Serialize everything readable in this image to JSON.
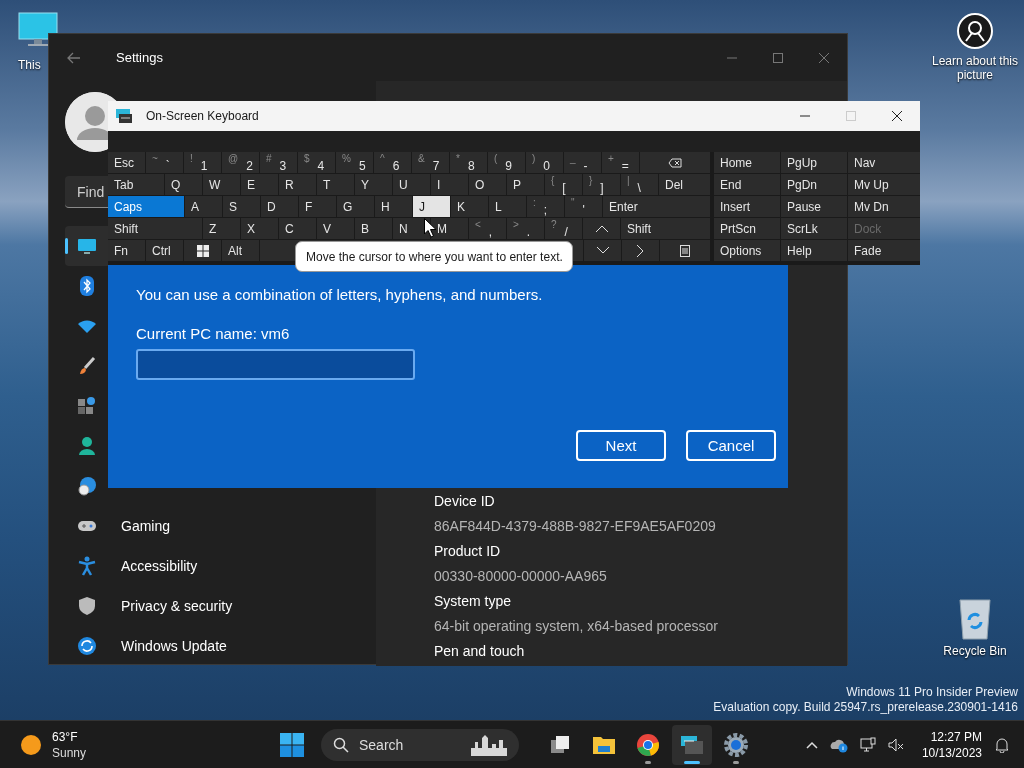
{
  "desktop": {
    "this_pc_label": "This",
    "learn_label": "Learn about this picture",
    "recycle_bin_label": "Recycle Bin"
  },
  "settings": {
    "title": "Settings",
    "search_placeholder": "Find",
    "sidebar": [
      {
        "selected": true
      },
      {
        "selected": false
      },
      {
        "selected": false
      },
      {
        "selected": false
      },
      {
        "selected": false
      },
      {
        "selected": false
      },
      {
        "selected": false
      },
      {
        "label": "Gaming",
        "selected": false
      },
      {
        "label": "Accessibility",
        "selected": false
      },
      {
        "label": "Privacy & security",
        "selected": false
      },
      {
        "label": "Windows Update",
        "selected": false
      }
    ],
    "about": [
      {
        "label": "Device ID",
        "value": "86AF844D-4379-488B-9827-EF9AE5AF0209"
      },
      {
        "label": "Product ID",
        "value": "00330-80000-00000-AA965"
      },
      {
        "label": "System type",
        "value": "64-bit operating system, x64-based processor"
      },
      {
        "label": "Pen and touch"
      }
    ]
  },
  "rename_dialog": {
    "hint": "You can use a combination of letters, hyphens, and numbers.",
    "current_name": "Current PC name: vm6",
    "buttons": [
      "Next",
      "Cancel"
    ]
  },
  "osk": {
    "title": "On-Screen Keyboard",
    "main_rows": [
      [
        {
          "kind": "text",
          "label": "Esc",
          "on": false,
          "hovered": false
        },
        {
          "kind": "dual",
          "shift": "~",
          "label": "`",
          "on": false,
          "hovered": false
        },
        {
          "kind": "dual",
          "shift": "!",
          "label": "1",
          "on": false,
          "hovered": false
        },
        {
          "kind": "dual",
          "shift": "@",
          "label": "2",
          "on": false,
          "hovered": false
        },
        {
          "kind": "dual",
          "shift": "#",
          "label": "3",
          "on": false,
          "hovered": false
        },
        {
          "kind": "dual",
          "shift": "$",
          "label": "4",
          "on": false,
          "hovered": false
        },
        {
          "kind": "dual",
          "shift": "%",
          "label": "5",
          "on": false,
          "hovered": false
        },
        {
          "kind": "dual",
          "shift": "^",
          "label": "6",
          "on": false,
          "hovered": false
        },
        {
          "kind": "dual",
          "shift": "&",
          "label": "7",
          "on": false,
          "hovered": false
        },
        {
          "kind": "dual",
          "shift": "*",
          "label": "8",
          "on": false,
          "hovered": false
        },
        {
          "kind": "dual",
          "shift": "(",
          "label": "9",
          "on": false,
          "hovered": false
        },
        {
          "kind": "dual",
          "shift": ")",
          "label": "0",
          "on": false,
          "hovered": false
        },
        {
          "kind": "dual",
          "shift": "_",
          "label": "-",
          "on": false,
          "hovered": false
        },
        {
          "kind": "dual",
          "shift": "+",
          "label": "=",
          "on": false,
          "hovered": false
        },
        {
          "kind": "backspace",
          "on": false,
          "hovered": false
        }
      ],
      [
        {
          "kind": "text",
          "label": "Tab",
          "on": false,
          "hovered": false
        },
        {
          "kind": "text",
          "label": "Q",
          "on": false,
          "hovered": false
        },
        {
          "kind": "text",
          "label": "W",
          "on": false,
          "hovered": false
        },
        {
          "kind": "text",
          "label": "E",
          "on": false,
          "hovered": false
        },
        {
          "kind": "text",
          "label": "R",
          "on": false,
          "hovered": false
        },
        {
          "kind": "text",
          "label": "T",
          "on": false,
          "hovered": false
        },
        {
          "kind": "text",
          "label": "Y",
          "on": false,
          "hovered": false
        },
        {
          "kind": "text",
          "label": "U",
          "on": false,
          "hovered": false
        },
        {
          "kind": "text",
          "label": "I",
          "on": false,
          "hovered": false
        },
        {
          "kind": "text",
          "label": "O",
          "on": false,
          "hovered": false
        },
        {
          "kind": "text",
          "label": "P",
          "on": false,
          "hovered": false
        },
        {
          "kind": "dual",
          "shift": "{",
          "label": "[",
          "on": false,
          "hovered": false
        },
        {
          "kind": "dual",
          "shift": "}",
          "label": "]",
          "on": false,
          "hovered": false
        },
        {
          "kind": "dual",
          "shift": "|",
          "label": "\\",
          "on": false,
          "hovered": false
        },
        {
          "kind": "text",
          "label": "Del",
          "on": false,
          "hovered": false
        }
      ],
      [
        {
          "kind": "text",
          "label": "Caps",
          "on": true,
          "hovered": false
        },
        {
          "kind": "text",
          "label": "A",
          "on": false,
          "hovered": false
        },
        {
          "kind": "text",
          "label": "S",
          "on": false,
          "hovered": false
        },
        {
          "kind": "text",
          "label": "D",
          "on": false,
          "hovered": false
        },
        {
          "kind": "text",
          "label": "F",
          "on": false,
          "hovered": false
        },
        {
          "kind": "text",
          "label": "G",
          "on": false,
          "hovered": false
        },
        {
          "kind": "text",
          "label": "H",
          "on": false,
          "hovered": false
        },
        {
          "kind": "text",
          "label": "J",
          "on": false,
          "hovered": true
        },
        {
          "kind": "text",
          "label": "K",
          "on": false,
          "hovered": false
        },
        {
          "kind": "text",
          "label": "L",
          "on": false,
          "hovered": false
        },
        {
          "kind": "dual",
          "shift": ":",
          "label": ";",
          "on": false,
          "hovered": false
        },
        {
          "kind": "dual",
          "shift": "\"",
          "label": "'",
          "on": false,
          "hovered": false
        },
        {
          "kind": "text",
          "label": "Enter",
          "on": false,
          "hovered": false
        }
      ],
      [
        {
          "kind": "text",
          "label": "Shift",
          "on": false,
          "hovered": false
        },
        {
          "kind": "text",
          "label": "Z",
          "on": false,
          "hovered": false
        },
        {
          "kind": "text",
          "label": "X",
          "on": false,
          "hovered": false
        },
        {
          "kind": "text",
          "label": "C",
          "on": false,
          "hovered": false
        },
        {
          "kind": "text",
          "label": "V",
          "on": false,
          "hovered": false
        },
        {
          "kind": "text",
          "label": "B",
          "on": false,
          "hovered": false
        },
        {
          "kind": "text",
          "label": "N",
          "on": false,
          "hovered": false
        },
        {
          "kind": "text",
          "label": "M",
          "on": false,
          "hovered": false
        },
        {
          "kind": "dual",
          "shift": "<",
          "label": ",",
          "on": false,
          "hovered": false
        },
        {
          "kind": "dual",
          "shift": ">",
          "label": ".",
          "on": false,
          "hovered": false
        },
        {
          "kind": "dual",
          "shift": "?",
          "label": "/",
          "on": false,
          "hovered": false
        },
        {
          "kind": "up",
          "on": false,
          "hovered": false
        },
        {
          "kind": "text",
          "label": "Shift",
          "on": false,
          "hovered": false
        }
      ],
      [
        {
          "kind": "text",
          "label": "Fn",
          "on": false,
          "hovered": false
        },
        {
          "kind": "text",
          "label": "Ctrl",
          "on": false,
          "hovered": false
        },
        {
          "kind": "windows",
          "on": false,
          "hovered": false
        },
        {
          "kind": "text",
          "label": "Alt",
          "on": false,
          "hovered": false
        },
        {
          "kind": "space",
          "on": false,
          "hovered": false
        },
        {
          "kind": "down",
          "on": false,
          "hovered": false
        },
        {
          "kind": "right",
          "on": false,
          "hovered": false
        },
        {
          "kind": "menu",
          "on": false,
          "hovered": false
        }
      ]
    ],
    "side_rows": [
      [
        {
          "label": "Home",
          "disabled": false
        },
        {
          "label": "PgUp",
          "disabled": false
        },
        {
          "label": "Nav",
          "disabled": false
        }
      ],
      [
        {
          "label": "End",
          "disabled": false
        },
        {
          "label": "PgDn",
          "disabled": false
        },
        {
          "label": "Mv Up",
          "disabled": false
        }
      ],
      [
        {
          "label": "Insert",
          "disabled": false
        },
        {
          "label": "Pause",
          "disabled": false
        },
        {
          "label": "Mv Dn",
          "disabled": false
        }
      ],
      [
        {
          "label": "PrtScn",
          "disabled": false
        },
        {
          "label": "ScrLk",
          "disabled": false
        },
        {
          "label": "Dock",
          "disabled": true
        }
      ],
      [
        {
          "label": "Options",
          "disabled": false
        },
        {
          "label": "Help",
          "disabled": false
        },
        {
          "label": "Fade",
          "disabled": false
        }
      ]
    ]
  },
  "tooltip": "Move the cursor to where you want to enter text.",
  "build_info": [
    "Windows 11 Pro Insider Preview",
    "Evaluation copy. Build 25947.rs_prerelease.230901-1416"
  ],
  "taskbar": {
    "weather": {
      "temperature": "63°F",
      "condition": "Sunny"
    },
    "search_placeholder": "Search",
    "apps": [
      {
        "selected": false,
        "running": false
      },
      {
        "selected": false,
        "running": false
      },
      {
        "selected": false,
        "running": true
      },
      {
        "selected": true,
        "running": true
      },
      {
        "selected": false,
        "running": true
      }
    ],
    "time": "12:27 PM",
    "date": "10/13/2023"
  }
}
